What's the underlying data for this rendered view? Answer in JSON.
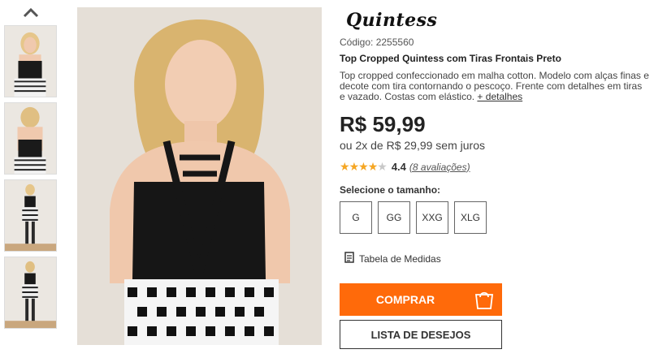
{
  "gallery": {
    "up_icon": "chevron-up-icon",
    "thumbnails": [
      {
        "view": "front"
      },
      {
        "view": "back"
      },
      {
        "view": "full-front"
      },
      {
        "view": "full-back"
      }
    ]
  },
  "product": {
    "brand": "Quintess",
    "code": "Código: 2255560",
    "title": "Top Cropped Quintess com Tiras Frontais Preto",
    "description": "Top cropped confeccionado em malha cotton. Modelo com alças finas e decote com tira contornando o pescoço. Frente com detalhes em tiras e vazado. Costas com elástico.",
    "more_details": "+ detalhes",
    "price": "R$ 59,99",
    "installments": "ou 2x de R$ 29,99 sem juros",
    "rating": {
      "value": 4.4,
      "score_text": "4.4",
      "count_text": "(8 avaliações)",
      "max": 5
    },
    "size_label": "Selecione o tamanho:",
    "sizes": [
      "G",
      "GG",
      "XXG",
      "XLG"
    ],
    "size_chart": "Tabela de Medidas",
    "buy_label": "COMPRAR",
    "wishlist_label": "LISTA DE DESEJOS"
  },
  "colors": {
    "accent": "#ff6a0a",
    "star": "#f5a623"
  }
}
